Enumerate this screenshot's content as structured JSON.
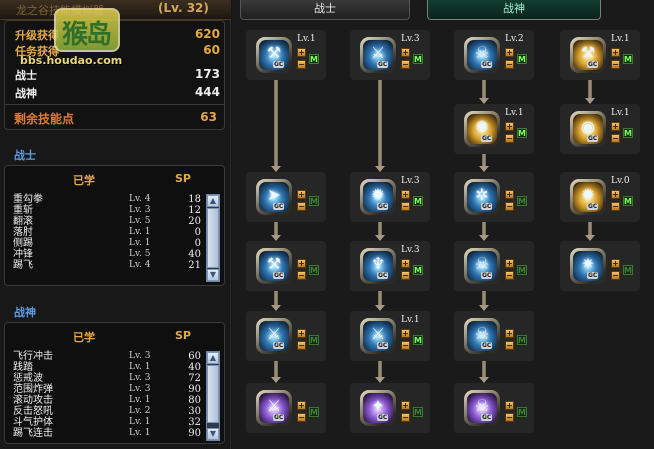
{
  "header": {
    "title": "龙之谷技能模拟器",
    "level": "(Lv. 32)"
  },
  "watermark": {
    "logo_text": "猴岛",
    "url": "bbs.houdao.com"
  },
  "stats": {
    "rows": [
      {
        "label": "升级获得",
        "value": "620",
        "color": "gold"
      },
      {
        "label": "任务获得",
        "value": "60",
        "color": "gold"
      },
      {
        "label": "战士",
        "value": "173",
        "color": "white"
      },
      {
        "label": "战神",
        "value": "444",
        "color": "white"
      }
    ],
    "remaining_label": "剩余技能点",
    "remaining_value": "63"
  },
  "warrior_section": {
    "label": "战士",
    "header_learned": "已学",
    "header_sp": "SP",
    "items": [
      {
        "name": "重勾拳",
        "lv": "Lv. 4",
        "sp": "18"
      },
      {
        "name": "重斩",
        "lv": "Lv. 3",
        "sp": "12"
      },
      {
        "name": "翻滚",
        "lv": "Lv. 5",
        "sp": "20"
      },
      {
        "name": "落肘",
        "lv": "Lv. 1",
        "sp": "0"
      },
      {
        "name": "侧踢",
        "lv": "Lv. 1",
        "sp": "0"
      },
      {
        "name": "冲锋",
        "lv": "Lv. 5",
        "sp": "40"
      },
      {
        "name": "踢飞",
        "lv": "Lv. 4",
        "sp": "21"
      }
    ]
  },
  "god_section": {
    "label": "战神",
    "header_learned": "已学",
    "header_sp": "SP",
    "items": [
      {
        "name": "飞行冲击",
        "lv": "Lv. 3",
        "sp": "60"
      },
      {
        "name": "践踏",
        "lv": "Lv. 1",
        "sp": "40"
      },
      {
        "name": "惩戒波",
        "lv": "Lv. 3",
        "sp": "72"
      },
      {
        "name": "范围炸弹",
        "lv": "Lv. 3",
        "sp": "90"
      },
      {
        "name": "滚动攻击",
        "lv": "Lv. 1",
        "sp": "80"
      },
      {
        "name": "反击怒吼",
        "lv": "Lv. 2",
        "sp": "30"
      },
      {
        "name": "斗气护体",
        "lv": "Lv. 1",
        "sp": "32"
      },
      {
        "name": "踢飞连击",
        "lv": "Lv. 1",
        "sp": "90"
      }
    ]
  },
  "tabs": [
    {
      "label": "战士",
      "active": false
    },
    {
      "label": "战神",
      "active": true
    }
  ],
  "skills": [
    {
      "lv": "Lv.1",
      "icon": "hammer-smash-icon",
      "style": "blue"
    },
    {
      "lv": "Lv.3",
      "icon": "axe-icon",
      "style": "blue"
    },
    {
      "lv": "Lv.2",
      "icon": "skull-roar-icon",
      "style": "blue"
    },
    {
      "lv": "Lv.1",
      "icon": "hammer-gold-icon",
      "style": "gold"
    },
    {
      "lv": "Lv.1",
      "icon": "gold-burst-icon",
      "style": "gold"
    },
    {
      "lv": "Lv.1",
      "icon": "gold-ring-icon",
      "style": "gold"
    },
    {
      "lv": "",
      "icon": "dash-strike-icon",
      "style": "blue"
    },
    {
      "lv": "Lv.3",
      "icon": "explosion-icon",
      "style": "blue"
    },
    {
      "lv": "",
      "icon": "spin-icon",
      "style": "blue"
    },
    {
      "lv": "Lv.0",
      "icon": "gold-explosion-icon",
      "style": "gold"
    },
    {
      "lv": "",
      "icon": "hammer-slam-icon",
      "style": "blue"
    },
    {
      "lv": "Lv.3",
      "icon": "ground-wave-icon",
      "style": "blue"
    },
    {
      "lv": "",
      "icon": "skull-shock-icon",
      "style": "blue"
    },
    {
      "lv": "",
      "icon": "shock-ring-icon",
      "style": "blue"
    },
    {
      "lv": "",
      "icon": "double-axe-icon",
      "style": "blue"
    },
    {
      "lv": "Lv.1",
      "icon": "axe-hit-icon",
      "style": "blue"
    },
    {
      "lv": "",
      "icon": "skull-icon",
      "style": "blue"
    },
    {
      "lv": "",
      "icon": "purple-axe-icon",
      "style": "purple"
    },
    {
      "lv": "",
      "icon": "purple-crystal-icon",
      "style": "purple"
    },
    {
      "lv": "",
      "icon": "purple-skull-icon",
      "style": "purple"
    }
  ],
  "skill_buttons": {
    "plus": "+",
    "minus": "−",
    "max": "M",
    "icon_badge": "GC"
  },
  "scroll": {
    "up": "▲",
    "down": "▼"
  }
}
